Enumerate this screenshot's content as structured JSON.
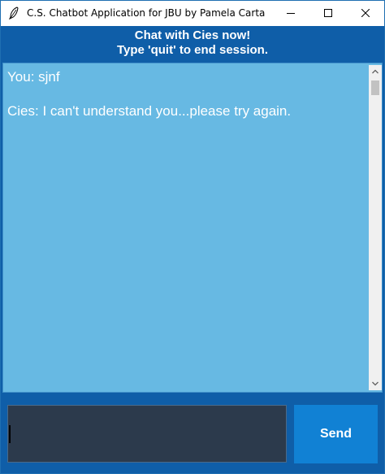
{
  "window": {
    "title": "C.S. Chatbot Application for JBU by Pamela Carta",
    "controls": {
      "minimize_icon": "minimize-icon",
      "maximize_icon": "maximize-icon",
      "close_icon": "close-icon"
    }
  },
  "header": {
    "line1": "Chat with Cies now!",
    "line2": "Type 'quit' to end session."
  },
  "chat": {
    "messages": [
      {
        "text": "You: sjnf"
      },
      {
        "text": "Cies: I can't understand you...please try again."
      }
    ]
  },
  "input": {
    "value": ""
  },
  "send_button": {
    "label": "Send"
  },
  "colors": {
    "header_bg": "#0f5ea8",
    "chat_bg": "#67b9e3",
    "input_bg": "#2c3a4c",
    "send_bg": "#1181d4",
    "text": "#ffffff"
  }
}
